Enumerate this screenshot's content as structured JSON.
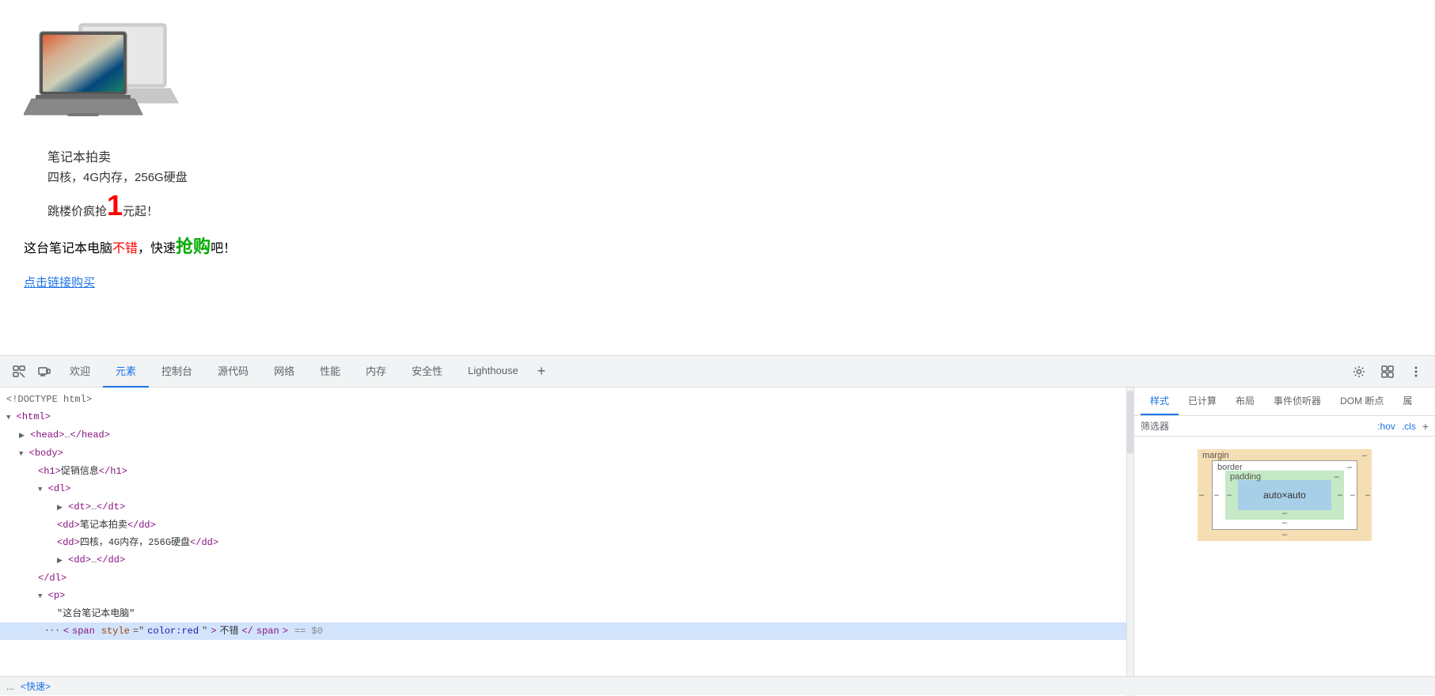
{
  "webpage": {
    "product_image_alt": "笔记本电脑",
    "product_title": "笔记本拍卖",
    "product_spec": "四核，4G内存，256G硬盘",
    "product_price_text": "跳楼价疯抢",
    "product_price_num": "1",
    "product_price_unit": "元起！",
    "promo_prefix": "这台笔记本电脑",
    "promo_red": "不错",
    "promo_comma": "，快速",
    "promo_green": "抢购",
    "promo_suffix": "吧！",
    "buy_link": "点击链接购买"
  },
  "devtools": {
    "tabs": [
      {
        "label": "欢迎",
        "active": false
      },
      {
        "label": "元素",
        "active": true
      },
      {
        "label": "控制台",
        "active": false
      },
      {
        "label": "源代码",
        "active": false
      },
      {
        "label": "网络",
        "active": false
      },
      {
        "label": "性能",
        "active": false
      },
      {
        "label": "内存",
        "active": false
      },
      {
        "label": "安全性",
        "active": false
      },
      {
        "label": "Lighthouse",
        "active": false
      }
    ],
    "dom": [
      {
        "indent": 0,
        "type": "doctype",
        "text": "<!DOCTYPE html>"
      },
      {
        "indent": 0,
        "type": "tag-open",
        "text": "<html>"
      },
      {
        "indent": 1,
        "type": "tag-collapsed",
        "text": "<head>…</head>"
      },
      {
        "indent": 1,
        "type": "tag-open",
        "text": "<body>",
        "expanded": true
      },
      {
        "indent": 2,
        "type": "tag-pair",
        "text": "<h1>促销信息</h1>"
      },
      {
        "indent": 2,
        "type": "tag-open",
        "text": "<dl>",
        "expanded": true
      },
      {
        "indent": 3,
        "type": "tag-collapsed",
        "text": "<dt>…</dt>"
      },
      {
        "indent": 3,
        "type": "tag-pair",
        "text": "<dd>笔记本拍卖</dd>"
      },
      {
        "indent": 3,
        "type": "tag-pair",
        "text": "<dd>四核，4G内存，256G硬盘</dd>"
      },
      {
        "indent": 3,
        "type": "tag-collapsed",
        "text": "<dd>…</dd>"
      },
      {
        "indent": 2,
        "type": "tag-close",
        "text": "</dl>"
      },
      {
        "indent": 2,
        "type": "tag-open",
        "text": "<p>",
        "expanded": true
      },
      {
        "indent": 3,
        "type": "text-node",
        "text": "\"这台笔记本电脑\""
      },
      {
        "indent": 2,
        "type": "selected",
        "text": "<span style=\"color:red\">不错</span>",
        "suffix": " == $0"
      }
    ],
    "bottom_text": "...",
    "bottom_next": "<快速>"
  },
  "styles_panel": {
    "tabs": [
      {
        "label": "样式",
        "active": true
      },
      {
        "label": "已计算",
        "active": false
      },
      {
        "label": "布局",
        "active": false
      },
      {
        "label": "事件侦听器",
        "active": false
      },
      {
        "label": "DOM 断点",
        "active": false
      },
      {
        "label": "属",
        "active": false
      }
    ],
    "filter_label": "筛选器",
    "filter_hov": ":hov",
    "filter_cls": ".cls",
    "box_model": {
      "margin_label": "margin",
      "margin_dash": "–",
      "border_label": "border",
      "border_dash": "–",
      "padding_label": "padding",
      "padding_dash": "–",
      "content_value": "auto×auto",
      "dash_bottom": "–"
    }
  }
}
